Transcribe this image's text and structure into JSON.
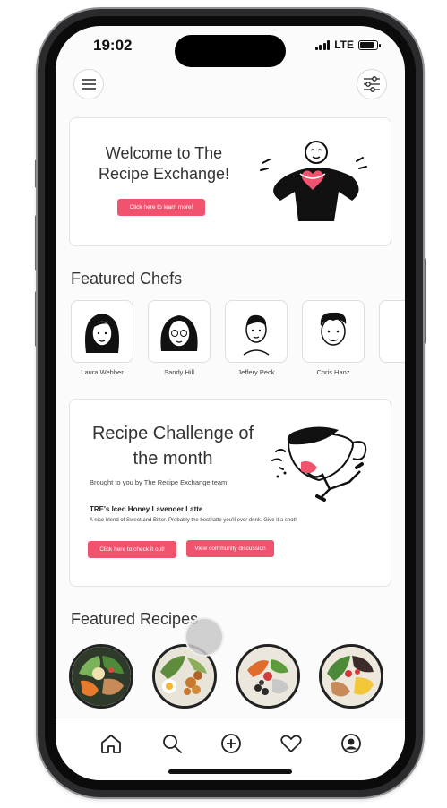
{
  "status": {
    "time": "19:02",
    "network": "LTE",
    "battery_percent": 85
  },
  "welcome": {
    "title": "Welcome to The Recipe Exchange!",
    "button": "Click here to learn more!"
  },
  "featured_chefs": {
    "title": "Featured Chefs",
    "chefs": [
      {
        "name": "Laura Webber"
      },
      {
        "name": "Sandy Hill"
      },
      {
        "name": "Jeffery Peck"
      },
      {
        "name": "Chris Hanz"
      }
    ]
  },
  "challenge": {
    "title": "Recipe Challenge of the month",
    "subtitle": "Brought to you by The Recipe Exchange team!",
    "recipe_name": "TRE's Iced Honey Lavender Latte",
    "description": "A nice blend of Sweet and Bitter. Probably the best latte you'll ever drink. Give it a shot!",
    "button_check": "Click here to check it out!",
    "button_discussion": "View community discussion"
  },
  "featured_recipes": {
    "title": "Featured Recipes"
  },
  "nav": {
    "items": [
      {
        "icon": "home-icon"
      },
      {
        "icon": "search-icon"
      },
      {
        "icon": "add-icon"
      },
      {
        "icon": "heart-icon"
      },
      {
        "icon": "profile-icon"
      }
    ]
  },
  "colors": {
    "accent": "#f1526e",
    "text": "#333333",
    "background": "#fbfbfb"
  }
}
